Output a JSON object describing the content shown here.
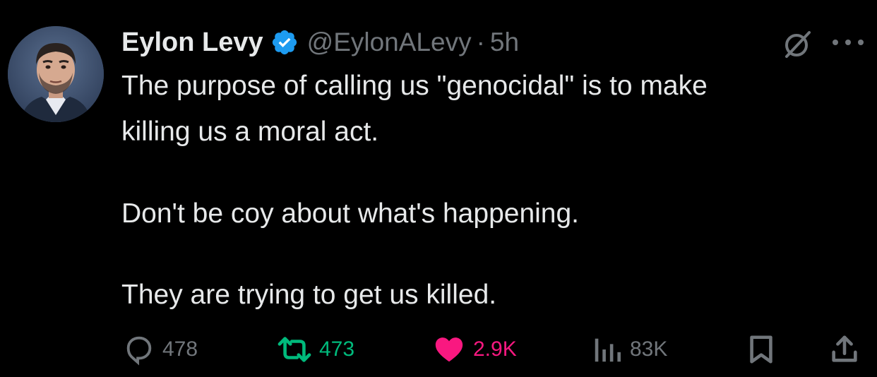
{
  "author": {
    "display_name": "Eylon Levy",
    "handle": "@EylonALevy",
    "separator": "·",
    "time": "5h",
    "verified": true
  },
  "tweet": {
    "lines": [
      "The purpose of calling us \"genocidal\" is to make",
      "killing us a moral act.",
      "Don't be coy about what's happening.",
      "They are trying to get us killed."
    ]
  },
  "actions": {
    "replies": "478",
    "retweets": "473",
    "likes": "2.9K",
    "views": "83K"
  },
  "colors": {
    "background": "#000000",
    "text": "#e7e9ea",
    "muted": "#71767b",
    "verified": "#1d9bf0",
    "retweet": "#00ba7c",
    "like": "#f91880"
  },
  "icons": {
    "verified": "verified-badge-icon",
    "grok": "grok-icon",
    "more": "more-options-icon",
    "reply": "reply-icon",
    "retweet": "retweet-icon",
    "like": "heart-icon",
    "views": "views-icon",
    "bookmark": "bookmark-icon",
    "share": "share-icon"
  }
}
